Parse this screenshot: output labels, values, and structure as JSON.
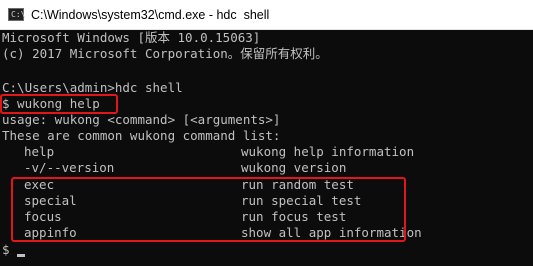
{
  "window": {
    "title": "C:\\Windows\\system32\\cmd.exe - hdc  shell",
    "icon": "console-icon"
  },
  "console": {
    "banner_1": "Microsoft Windows [版本 10.0.15063]",
    "banner_2": "(c) 2017 Microsoft Corporation。保留所有权利。",
    "prompt_line": "C:\\Users\\admin>hdc shell",
    "shell_cmd": "$ wukong help",
    "usage": "usage: wukong <command> [<arguments>]",
    "list_header": "These are common wukong command list:",
    "commands": [
      {
        "name": "help",
        "desc": "wukong help information"
      },
      {
        "name": "-v/--version",
        "desc": "wukong version"
      },
      {
        "name": "exec",
        "desc": "run random test"
      },
      {
        "name": "special",
        "desc": "run special test"
      },
      {
        "name": "focus",
        "desc": "run focus test"
      },
      {
        "name": "appinfo",
        "desc": "show all app information"
      }
    ],
    "final_prompt": "$"
  },
  "colors": {
    "terminal_bg": "#0c0c0c",
    "terminal_fg": "#c0c0c0",
    "annotation": "#e0161b"
  }
}
